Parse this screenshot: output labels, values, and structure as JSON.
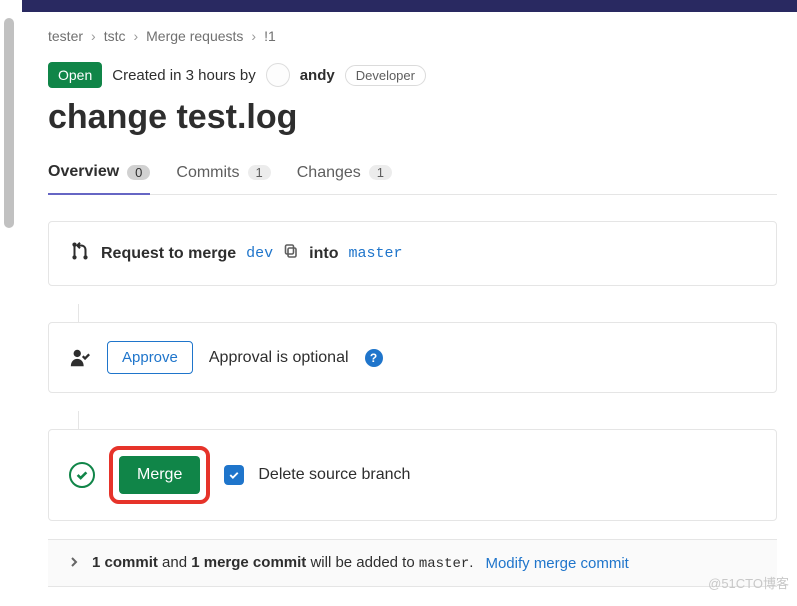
{
  "breadcrumbs": {
    "items": [
      "tester",
      "tstc",
      "Merge requests",
      "!1"
    ]
  },
  "header": {
    "status": "Open",
    "created_prefix": "Created in",
    "created_time": "3 hours",
    "created_by": "by",
    "author": "andy",
    "role": "Developer"
  },
  "title": "change test.log",
  "tabs": [
    {
      "label": "Overview",
      "count": "0",
      "active": true
    },
    {
      "label": "Commits",
      "count": "1",
      "active": false
    },
    {
      "label": "Changes",
      "count": "1",
      "active": false
    }
  ],
  "merge_request": {
    "request_label": "Request to merge",
    "source_branch": "dev",
    "into_label": "into",
    "target_branch": "master"
  },
  "approval": {
    "approve_label": "Approve",
    "optional_text": "Approval is optional"
  },
  "merge_action": {
    "merge_label": "Merge",
    "delete_label": "Delete source branch",
    "checked": true
  },
  "commit_summary": {
    "count1": "1 commit",
    "and": "and",
    "count2": "1 merge commit",
    "rest": "will be added to",
    "target": "master",
    "dot": ".",
    "link": "Modify merge commit"
  },
  "watermark": "@51CTO博客"
}
